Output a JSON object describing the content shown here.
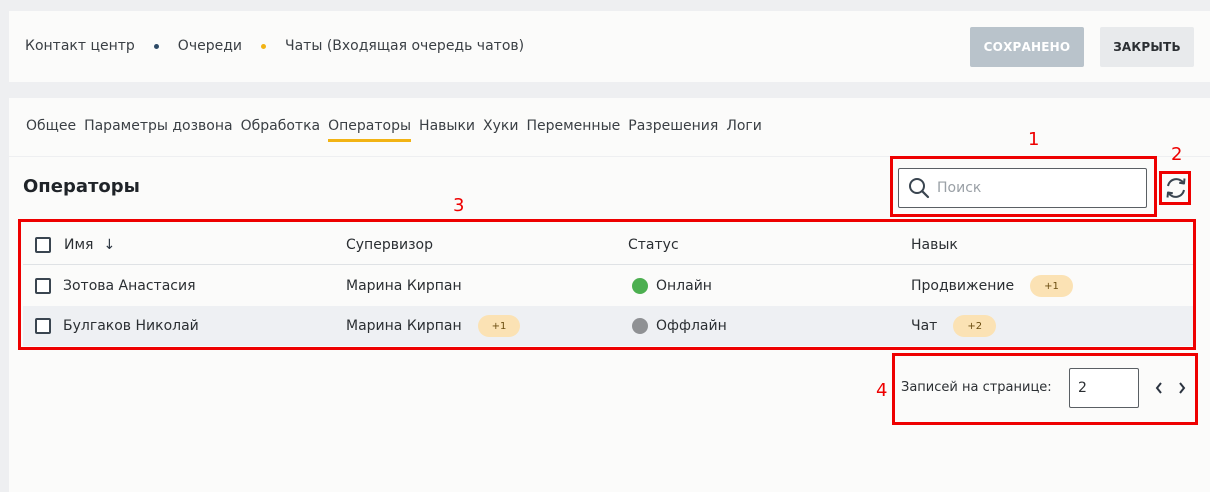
{
  "breadcrumb": [
    {
      "label": "Контакт центр"
    },
    {
      "label": "Очереди"
    },
    {
      "label": "Чаты (Входящая очередь чатов)"
    }
  ],
  "breadcrumb_dot_colors": [
    "#2d4a66",
    "#f2b314"
  ],
  "buttons": {
    "saved": "СОХРАНЕНО",
    "close": "ЗАКРЫТЬ"
  },
  "tabs": [
    {
      "label": "Общее"
    },
    {
      "label": "Параметры дозвона"
    },
    {
      "label": "Обработка"
    },
    {
      "label": "Операторы",
      "active": true
    },
    {
      "label": "Навыки"
    },
    {
      "label": "Хуки"
    },
    {
      "label": "Переменные"
    },
    {
      "label": "Разрешения"
    },
    {
      "label": "Логи"
    }
  ],
  "section_title": "Операторы",
  "search": {
    "placeholder": "Поиск",
    "value": ""
  },
  "table": {
    "columns": [
      "Имя",
      "Супервизор",
      "Статус",
      "Навык"
    ],
    "sort": "↓",
    "rows": [
      {
        "name": "Зотова Анастасия",
        "supervisor": "Марина Кирпан",
        "supervisor_badge": "",
        "status": "Онлайн",
        "status_color": "#4caf50",
        "skill": "Продвижение",
        "skill_badge": "+1"
      },
      {
        "name": "Булгаков Николай",
        "supervisor": "Марина Кирпан",
        "supervisor_badge": "+1",
        "status": "Оффлайн",
        "status_color": "#8f9194",
        "skill": "Чат",
        "skill_badge": "+2"
      }
    ]
  },
  "pagination": {
    "label": "Записей на странице:",
    "value": "2"
  },
  "annotations": [
    "1",
    "2",
    "3",
    "4"
  ],
  "colors": {
    "accent": "#f2b314",
    "annotation": "#ee0000"
  }
}
